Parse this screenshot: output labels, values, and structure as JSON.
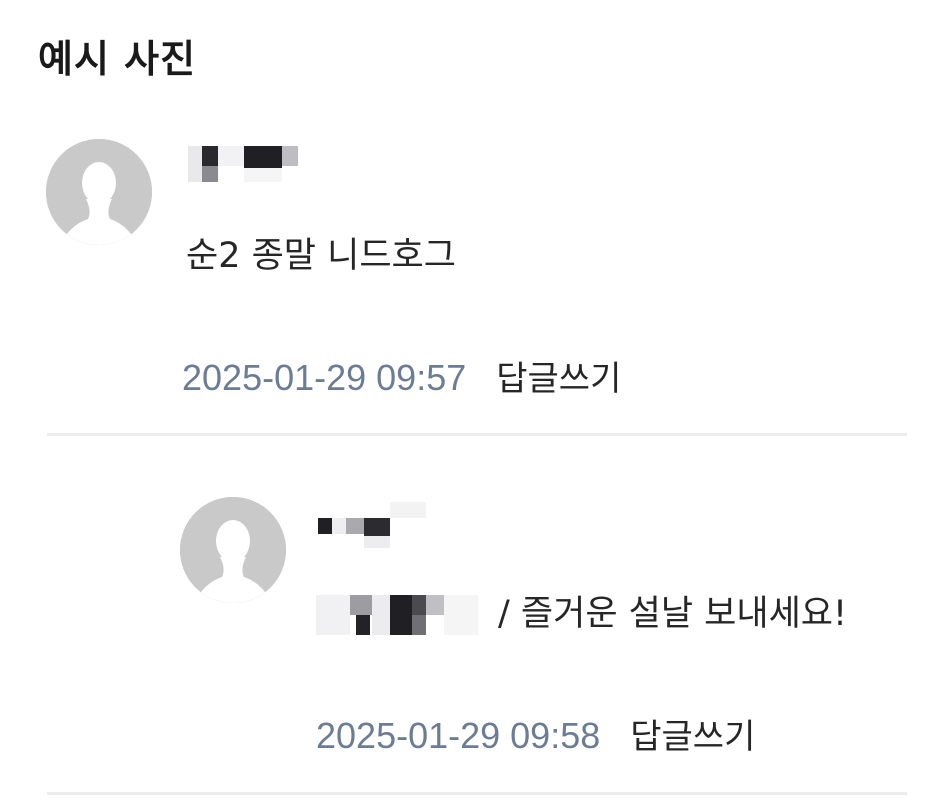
{
  "section": {
    "title": "예시 사진"
  },
  "icons": {
    "avatar": "default-user-silhouette-icon"
  },
  "comments": [
    {
      "text": "순2 종말 니드호그",
      "timestamp": "2025-01-29 09:57",
      "reply_label": "답글쓰기"
    }
  ],
  "replies": [
    {
      "text_tail": "/ 즐거운 설날 보내세요!",
      "timestamp": "2025-01-29 09:58",
      "reply_label": "답글쓰기"
    }
  ],
  "colors": {
    "timestamp": "#6b7d96",
    "avatar_bg": "#c9c9c9",
    "divider": "#ececec"
  }
}
